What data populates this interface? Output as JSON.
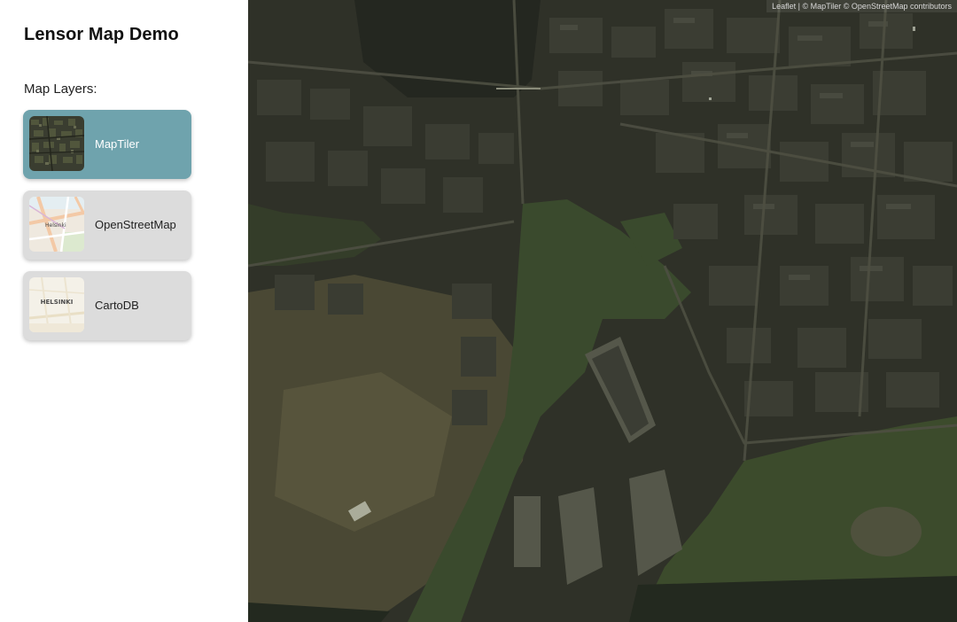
{
  "app": {
    "title": "Lensor Map Demo"
  },
  "sidebar": {
    "layers_label": "Map Layers:",
    "layers": [
      {
        "label": "MapTiler",
        "active": true,
        "thumb_icon": "satellite-thumbnail"
      },
      {
        "label": "OpenStreetMap",
        "active": false,
        "thumb_icon": "street-map-thumbnail"
      },
      {
        "label": "CartoDB",
        "active": false,
        "thumb_icon": "carto-light-thumbnail",
        "thumb_text": "HELSINKI"
      }
    ]
  },
  "map": {
    "active_layer": "MapTiler",
    "attribution": {
      "leaflet": "Leaflet",
      "separator": "|",
      "maptiler": "© MapTiler",
      "osm": "© OpenStreetMap contributors"
    }
  },
  "colors": {
    "active_card": "#6fa3ad",
    "inactive_card": "#dcdcdc",
    "water": "#3c4a2d",
    "land": "#2f3128"
  }
}
